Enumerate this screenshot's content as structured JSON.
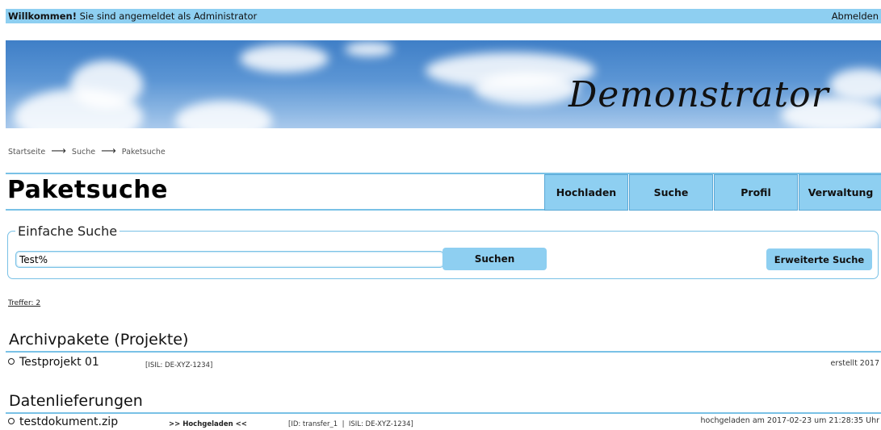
{
  "topbar": {
    "welcome_bold": "Willkommen!",
    "welcome_text": "Sie sind angemeldet als Administrator",
    "logout": "Abmelden"
  },
  "banner": {
    "title": "Demonstrator"
  },
  "breadcrumb": {
    "items": [
      "Startseite",
      "Suche",
      "Paketsuche"
    ]
  },
  "page": {
    "title": "Paketsuche"
  },
  "nav": {
    "items": [
      "Hochladen",
      "Suche",
      "Profil",
      "Verwaltung"
    ]
  },
  "search": {
    "legend": "Einfache Suche",
    "value": "Test%",
    "submit": "Suchen",
    "advanced": "Erweiterte Suche"
  },
  "results": {
    "hits": "Treffer: 2",
    "archive": {
      "title": "Archivpakete (Projekte)",
      "items": [
        {
          "name": "Testprojekt 01",
          "meta": "[ISIL: DE-XYZ-1234]",
          "right": "erstellt 2017"
        }
      ]
    },
    "deliveries": {
      "title": "Datenlieferungen",
      "items": [
        {
          "name": "testdokument.zip",
          "status": ">> Hochgeladen <<",
          "meta": "[ID: transfer_1  |  ISIL: DE-XYZ-1234]",
          "right": "hochgeladen am 2017-02-23 um 21:28:35 Uhr"
        }
      ]
    }
  },
  "colors": {
    "accent": "#8ecff1",
    "line": "#79c1e6"
  },
  "icons": {
    "breadcrumb_separator": "arrow-right-icon",
    "list_bullet": "circle-bullet-icon"
  }
}
